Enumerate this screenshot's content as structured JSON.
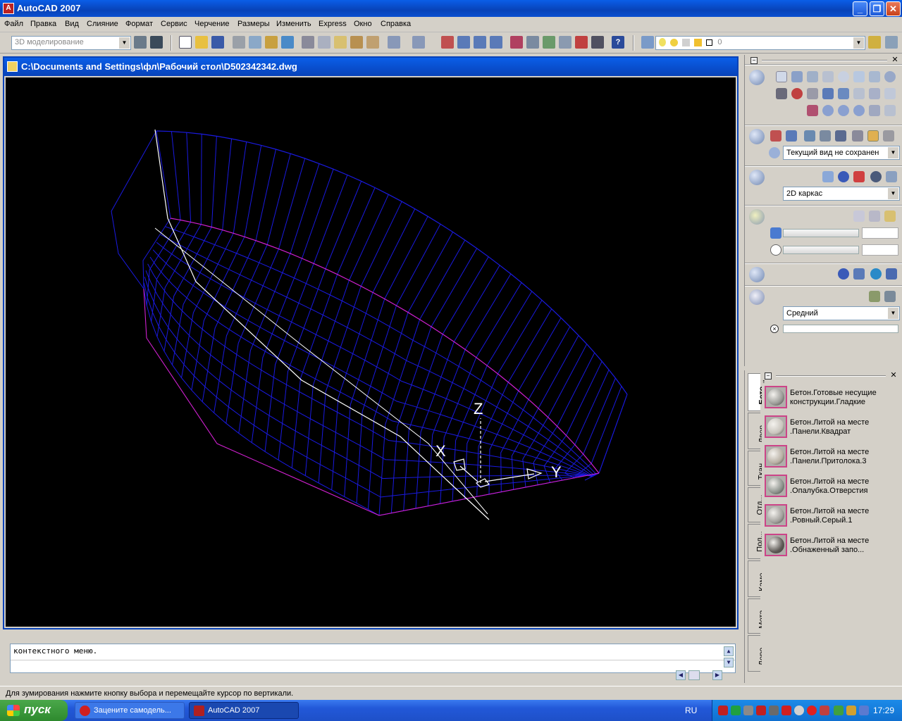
{
  "window": {
    "title": "AutoCAD 2007",
    "buttons": [
      "_",
      "❐",
      "✕"
    ]
  },
  "menu": [
    "Файл",
    "Правка",
    "Вид",
    "Слияние",
    "Формат",
    "Сервис",
    "Черчение",
    "Размеры",
    "Изменить",
    "Express",
    "Окно",
    "Справка"
  ],
  "toolbar": {
    "workspace": "3D моделирование",
    "layer_value": "0"
  },
  "document": {
    "title": "C:\\Documents and Settings\\фл\\Рабочий стол\\D502342342.dwg"
  },
  "ucs": {
    "x_label": "X",
    "y_label": "Y",
    "z_label": "Z"
  },
  "command": {
    "history": "контекстного меню."
  },
  "status": {
    "prompt": "Для зумирования нажмите кнопку выбора и перемещайте курсор по вертикали."
  },
  "dashboard": {
    "view_combo": "Текущий вид не сохранен",
    "visual_style_combo": "2D каркас",
    "render_quality_combo": "Средний"
  },
  "tool_palette": {
    "tabs": [
      "Бето...",
      "Двер...",
      "Ткан...",
      "Отд...",
      "Пол...",
      "Каме...",
      "Мета...",
      "Дере..."
    ],
    "materials": [
      {
        "name": "Бетон.Готовые несущие конструкции.Гладкие",
        "color": "#9a9a96"
      },
      {
        "name": "Бетон.Литой на месте .Панели.Квадрат",
        "color": "#c8c4bc"
      },
      {
        "name": "Бетон.Литой на месте .Панели.Притолока.3",
        "color": "#b8b0a4"
      },
      {
        "name": "Бетон.Литой на месте .Опалубка.Отверстия",
        "color": "#8c928c"
      },
      {
        "name": "Бетон.Литой на месте .Ровный.Серый.1",
        "color": "#a2a09c"
      },
      {
        "name": "Бетон.Литой на месте .Обнаженный запо...",
        "color": "#5e5a56"
      }
    ]
  },
  "taskbar": {
    "start": "пуск",
    "tasks": [
      "Зацените самодель...",
      "AutoCAD 2007"
    ],
    "lang": "RU",
    "clock": "17:29"
  },
  "colors": {
    "hull_blue": "#1a1ae0",
    "sheer_magenta": "#d020d0",
    "keel_white": "#ffffff",
    "canvas": "#000000"
  }
}
